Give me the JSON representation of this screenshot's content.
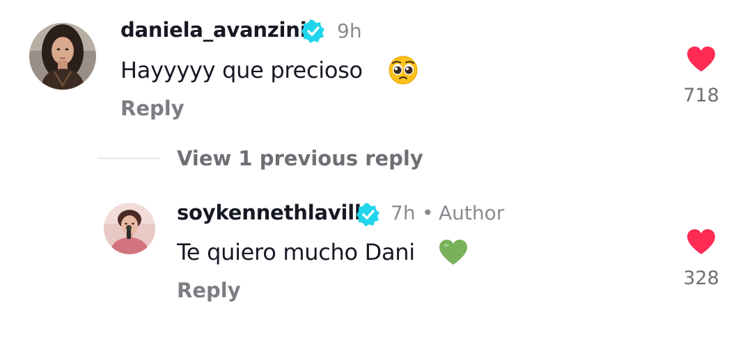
{
  "comments": [
    {
      "username": "daniela_avanzini",
      "time": "9h",
      "text": "Hayyyyy que precioso",
      "text_emoji": "pleading-face-emoji",
      "reply_label": "Reply",
      "like_count": "718",
      "like_icon": "heart-icon",
      "verified_icon": "verified-badge-icon",
      "liked": true
    },
    {
      "username": "soykennethlavill",
      "time": "7h",
      "separator": "•",
      "author_label": "Author",
      "text": "Te quiero mucho Dani",
      "text_emoji": "green-heart-emoji",
      "reply_label": "Reply",
      "like_count": "328",
      "like_icon": "heart-icon",
      "verified_icon": "verified-badge-icon",
      "liked": true
    }
  ],
  "view_replies": {
    "label": "View 1 previous reply"
  },
  "colors": {
    "heart": "#fe2c55",
    "verified": "#20d5ec",
    "text": "#161823",
    "muted": "#8a8b91"
  }
}
